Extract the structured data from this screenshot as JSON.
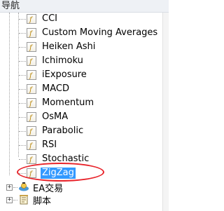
{
  "header": {
    "title": "导航"
  },
  "indicators": [
    {
      "label": "CCI"
    },
    {
      "label": "Custom Moving Averages"
    },
    {
      "label": "Heiken Ashi"
    },
    {
      "label": "Ichimoku"
    },
    {
      "label": "iExposure"
    },
    {
      "label": "MACD"
    },
    {
      "label": "Momentum"
    },
    {
      "label": "OsMA"
    },
    {
      "label": "Parabolic"
    },
    {
      "label": "RSI"
    },
    {
      "label": "Stochastic"
    },
    {
      "label": "ZigZag",
      "selected": true
    }
  ],
  "roots": [
    {
      "label": "EA交易",
      "icon": "expert-advisor-icon",
      "expander": "+"
    },
    {
      "label": "脚本",
      "icon": "script-icon",
      "expander": "+"
    }
  ],
  "colors": {
    "selection": "#3399ff",
    "highlight_ellipse": "#e8232a"
  }
}
